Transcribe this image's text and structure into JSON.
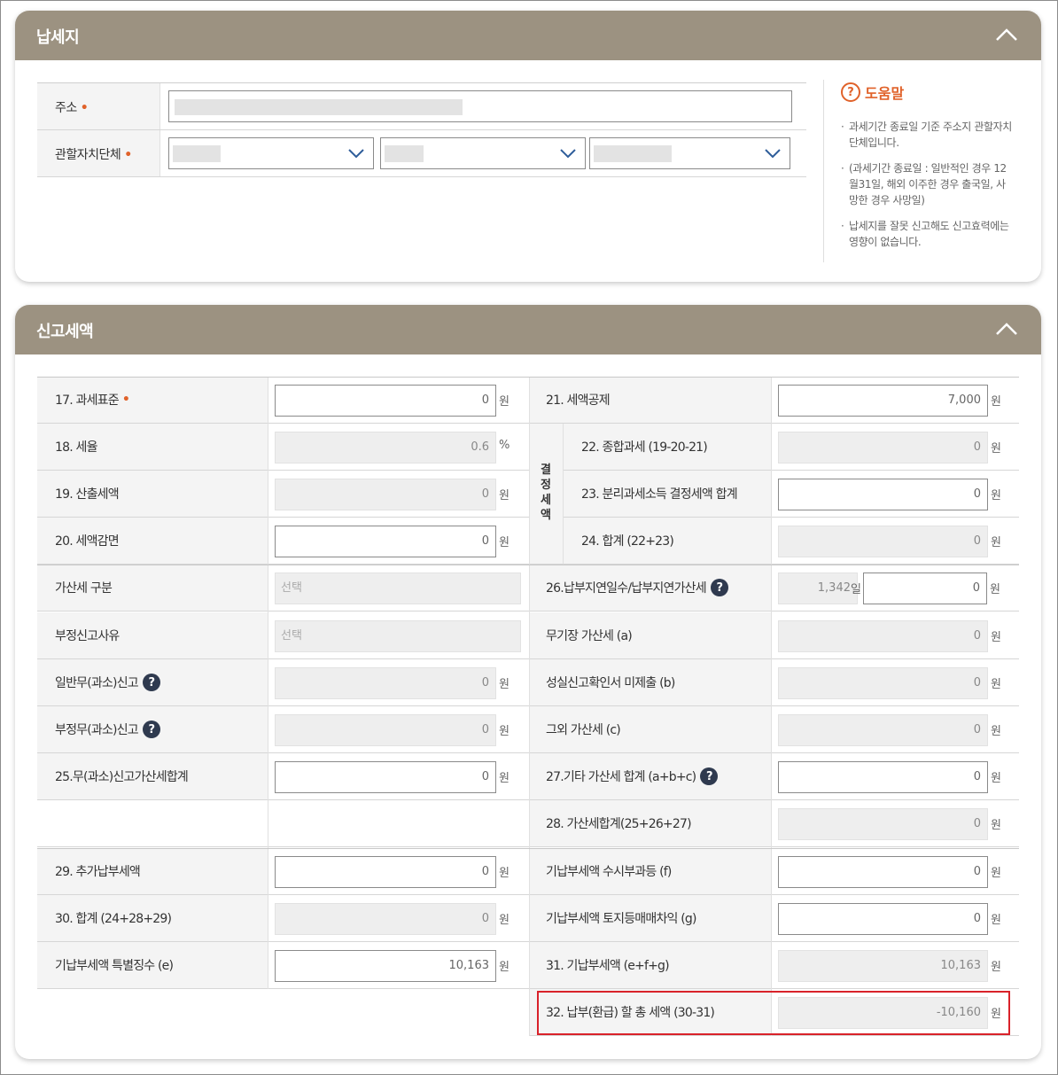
{
  "panel1": {
    "title": "납세지",
    "address_label": "주소",
    "required_mark": "•",
    "jurisdiction_label": "관할자치단체",
    "help": {
      "title": "도움말",
      "items": [
        "과세기간 종료일 기준 주소지 관할자치단체입니다.",
        "(과세기간 종료일 : 일반적인 경우 12월31일, 해외 이주한 경우 출국일, 사망한 경우 사망일)",
        "납세지를 잘못 신고해도 신고효력에는 영향이 없습니다."
      ]
    }
  },
  "panel2": {
    "title": "신고세액",
    "unit_won": "원",
    "unit_pct": "%",
    "unit_day": "일",
    "vertical_label": "결정세액",
    "left_rows": [
      {
        "label": "17. 과세표준",
        "value": "0"
      },
      {
        "label": "18. 세율",
        "value": "0.6"
      },
      {
        "label": "19. 산출세액",
        "value": "0"
      },
      {
        "label": "20. 세액감면",
        "value": "0"
      },
      {
        "label": "가산세 구분",
        "value": "선택"
      },
      {
        "label": "부정신고사유",
        "value": "선택"
      },
      {
        "label": "일반무(과소)신고",
        "value": "0"
      },
      {
        "label": "부정무(과소)신고",
        "value": "0"
      },
      {
        "label": "25.무(과소)신고가산세합계",
        "value": "0"
      },
      {
        "label": "29. 추가납부세액",
        "value": "0"
      },
      {
        "label": "30. 합계 (24+28+29)",
        "value": "0"
      },
      {
        "label": "기납부세액 특별징수 (e)",
        "value": "10,163"
      }
    ],
    "right_rows": [
      {
        "label": "21. 세액공제",
        "value": "7,000"
      },
      {
        "label": "22. 종합과세 (19-20-21)",
        "value": "0"
      },
      {
        "label": "23. 분리과세소득 결정세액 합계",
        "value": "0"
      },
      {
        "label": "24. 합계 (22+23)",
        "value": "0"
      },
      {
        "label": "26.납부지연일수/납부지연가산세",
        "days": "1,342",
        "value": "0"
      },
      {
        "label": "무기장 가산세 (a)",
        "value": "0"
      },
      {
        "label": "성실신고확인서 미제출 (b)",
        "value": "0"
      },
      {
        "label": "그외 가산세 (c)",
        "value": "0"
      },
      {
        "label": "27.기타 가산세 합계 (a+b+c)",
        "value": "0"
      },
      {
        "label": "28. 가산세합계(25+26+27)",
        "value": "0"
      },
      {
        "label": "기납부세액 수시부과등 (f)",
        "value": "0"
      },
      {
        "label": "기납부세액 토지등매매차익 (g)",
        "value": "0"
      },
      {
        "label": "31. 기납부세액 (e+f+g)",
        "value": "10,163"
      },
      {
        "label": "32. 납부(환급) 할 총 세액 (30-31)",
        "value": "-10,160"
      }
    ],
    "help_icon": "?"
  },
  "icons": {
    "collapse": "chevron-up-icon",
    "dropdown": "chevron-down-icon",
    "help": "question-circle-icon"
  },
  "colors": {
    "header_bg": "#9c9281",
    "accent": "#e0622a",
    "highlight_border": "#d9222a"
  }
}
